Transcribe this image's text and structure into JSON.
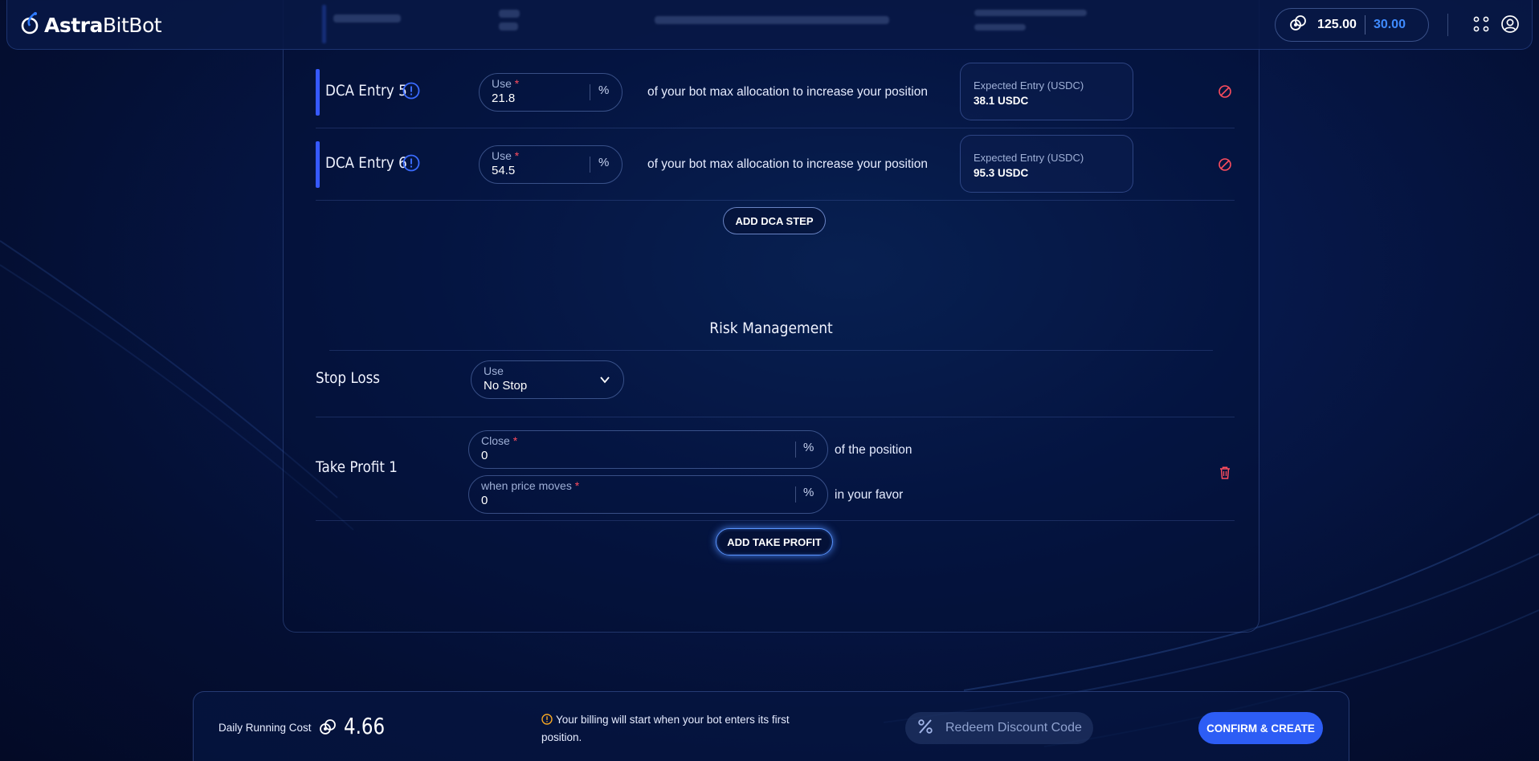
{
  "header": {
    "logo_text_bold": "Astra",
    "logo_text_regular": "BitBot",
    "balance_value": "125.00",
    "credit_value": "30.00"
  },
  "dca_entries": [
    {
      "title": "DCA Entry 5",
      "use_label": "Use",
      "use_value": "21.8",
      "unit": "%",
      "description": "of your bot max allocation to increase your position",
      "expected_label": "Expected Entry (USDC)",
      "expected_value": "38.1 USDC"
    },
    {
      "title": "DCA Entry 6",
      "use_label": "Use",
      "use_value": "54.5",
      "unit": "%",
      "description": "of your bot max allocation to increase your position",
      "expected_label": "Expected Entry (USDC)",
      "expected_value": "95.3 USDC"
    }
  ],
  "add_dca_step_label": "ADD DCA STEP",
  "risk_management": {
    "title": "Risk Management",
    "stop_loss": {
      "label": "Stop Loss",
      "select_label": "Use",
      "select_value": "No Stop"
    },
    "take_profit": {
      "label": "Take Profit 1",
      "close_label": "Close",
      "close_value": "0",
      "close_unit": "%",
      "close_suffix": "of the position",
      "price_label": "when price moves",
      "price_value": "0",
      "price_unit": "%",
      "price_suffix": "in your favor"
    },
    "add_take_profit_label": "ADD TAKE PROFIT"
  },
  "footer": {
    "daily_cost_label": "Daily Running Cost",
    "daily_cost_value": "4.66",
    "billing_notice": "Your billing will start when your bot enters its first position.",
    "discount_label": "Redeem Discount Code",
    "confirm_label": "CONFIRM & CREATE"
  },
  "colors": {
    "accent": "#3659ff",
    "primary_button": "#2d5df5",
    "credit": "#3f8bff",
    "danger": "#ff4d5e",
    "warning": "#f5a623"
  },
  "icons": [
    "logo-icon",
    "coins-icon",
    "apps-grid-icon",
    "user-icon",
    "info-icon",
    "cancel-icon",
    "chevron-down-icon",
    "trash-icon",
    "percent-icon",
    "warning-icon"
  ]
}
